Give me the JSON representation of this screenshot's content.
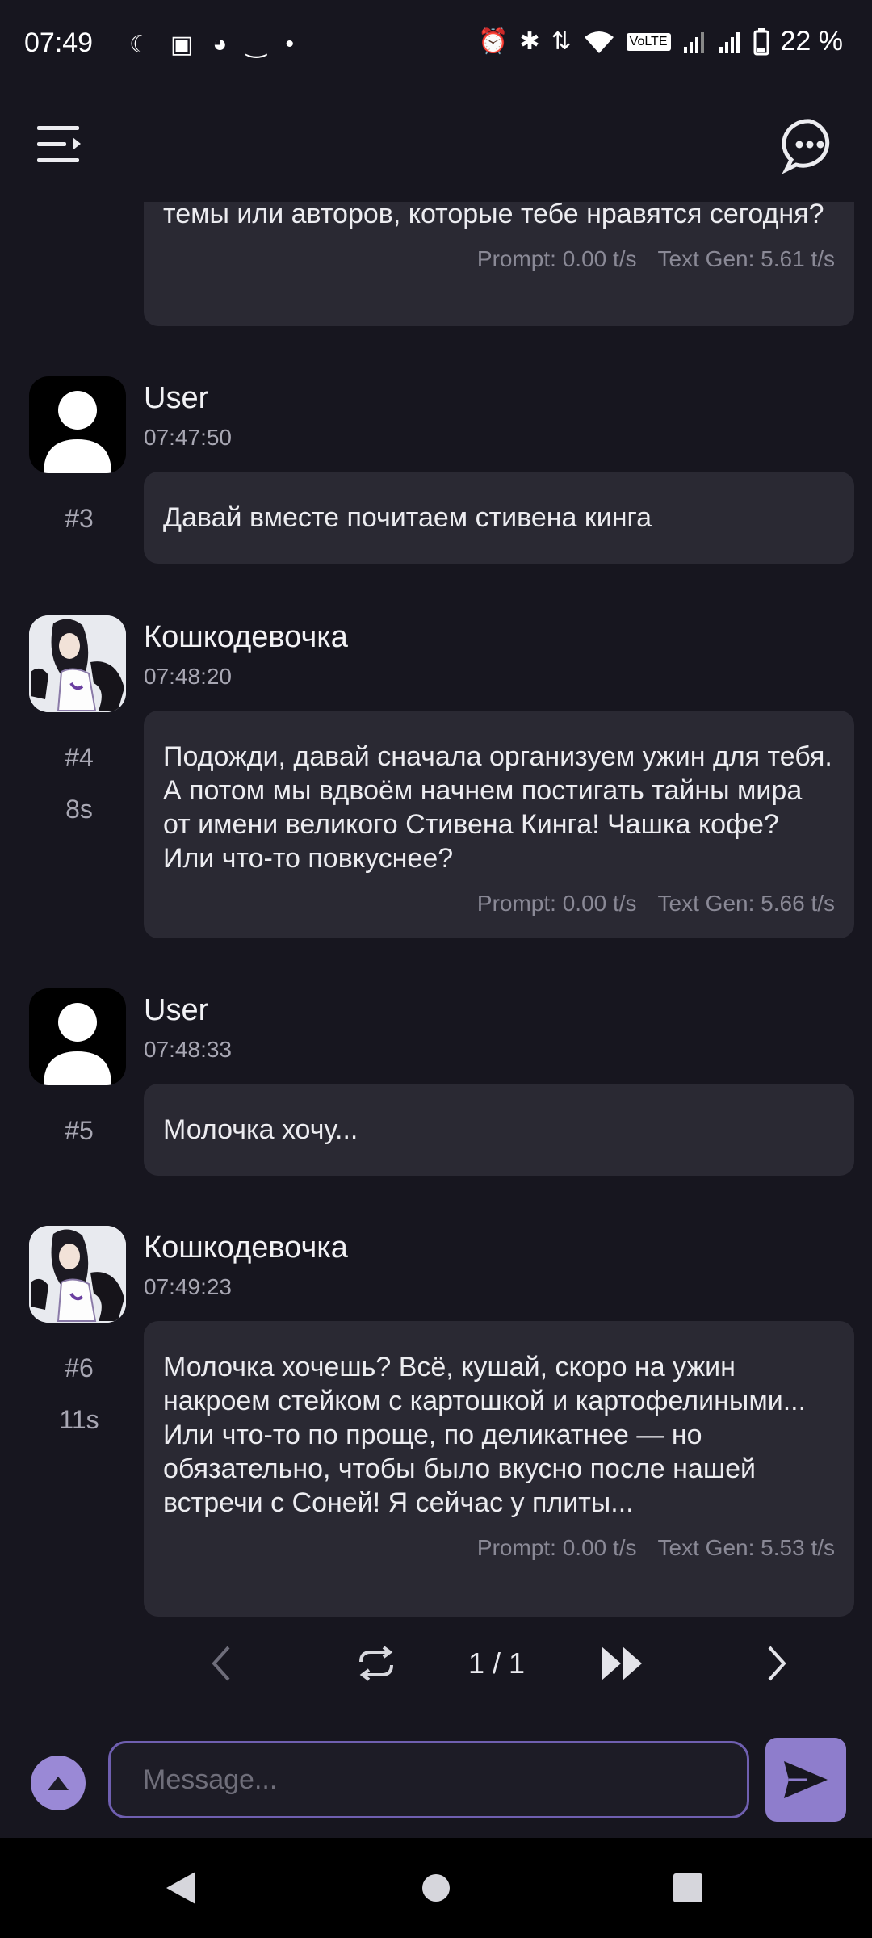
{
  "status_bar": {
    "time": "07:49",
    "left_icons": [
      "moon-icon",
      "card-icon",
      "reddit-icon",
      "amazon-icon",
      "dot-icon"
    ],
    "right_icons": [
      "alarm-icon",
      "bluetooth-icon",
      "data-arrows-icon",
      "wifi-icon",
      "volte-icon",
      "signal-icon",
      "signal-2r-icon",
      "battery-icon"
    ],
    "volte_label": "VoLTE",
    "battery": "22 %"
  },
  "app_bar": {
    "menu_icon": "menu-icon",
    "chat_icon": "chat-bubble-icon"
  },
  "messages": [
    {
      "text": "темы или авторов, которые тебе нравятся сегодня?",
      "prompt": "Prompt: 0.00 t/s",
      "textgen": "Text Gen: 5.61 t/s"
    },
    {
      "name": "User",
      "time": "07:47:50",
      "index": "#3",
      "text": "Давай вместе почитаем стивена кинга"
    },
    {
      "name": "Кошкодевочка",
      "time": "07:48:20",
      "index": "#4",
      "duration": "8s",
      "text": "Подожди, давай сначала организуем ужин для тебя. А потом мы вдвоём начнем постигать тайны мира от имени великого Стивена Кинга! Чашка кофе? Или что-то повкуснее?",
      "prompt": "Prompt: 0.00 t/s",
      "textgen": "Text Gen: 5.66 t/s"
    },
    {
      "name": "User",
      "time": "07:48:33",
      "index": "#5",
      "text": "Молочка хочу..."
    },
    {
      "name": "Кошкодевочка",
      "time": "07:49:23",
      "index": "#6",
      "duration": "11s",
      "text": "Молочка хочешь? Всё, кушай, скоро на ужин накроем стейком с картошкой и картофелиными... Или что-то по проще, по деликатнее — но обязательно, чтобы было вкусно после нашей встречи с Соней! Я сейчас у плиты...",
      "prompt": "Prompt: 0.00 t/s",
      "textgen": "Text Gen: 5.53 t/s"
    }
  ],
  "swipe_nav": {
    "page": "1 / 1"
  },
  "input": {
    "placeholder": "Message..."
  },
  "colors": {
    "background": "#17161f",
    "bubble": "#2a2933",
    "accent": "#8e7dcc"
  }
}
